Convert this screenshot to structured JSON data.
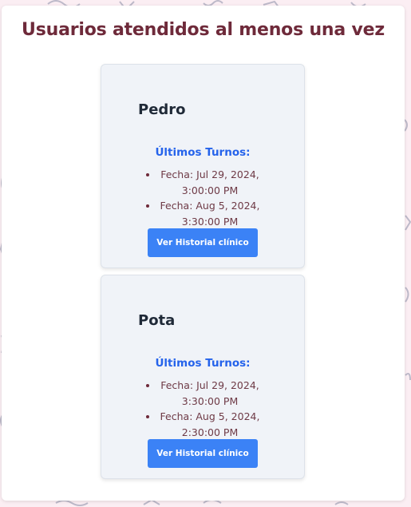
{
  "page": {
    "title": "Usuarios atendidos al menos una vez"
  },
  "section_label": "Últimos Turnos:",
  "users": [
    {
      "name": "Pedro",
      "turnos": [
        {
          "line1": "Fecha: Jul 29, 2024,",
          "line2": "3:00:00 PM"
        },
        {
          "line1": "Fecha: Aug 5, 2024,",
          "line2": "3:30:00 PM"
        }
      ],
      "button_label": "Ver Historial clínico"
    },
    {
      "name": "Pota",
      "turnos": [
        {
          "line1": "Fecha: Jul 29, 2024,",
          "line2": "3:30:00 PM"
        },
        {
          "line1": "Fecha: Aug 5, 2024,",
          "line2": "2:30:00 PM"
        }
      ],
      "button_label": "Ver Historial clínico"
    }
  ],
  "colors": {
    "title": "#6e2a3a",
    "section_label": "#2563eb",
    "button": "#3b82f6",
    "card_background": "#f0f3f8",
    "page_background": "#fbeef3"
  }
}
